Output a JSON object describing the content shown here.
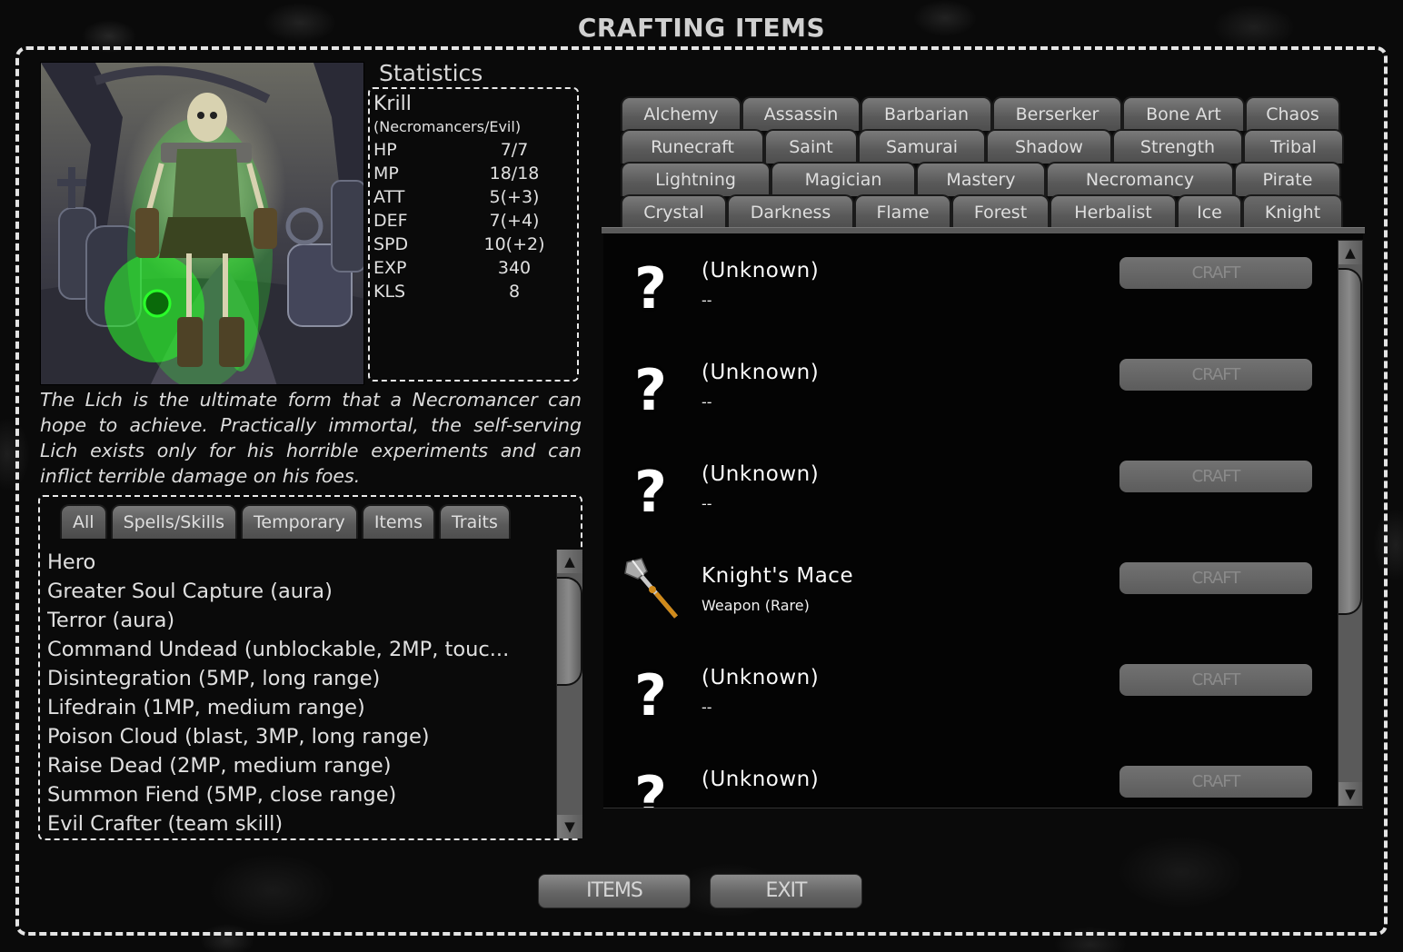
{
  "title": "CRAFTING ITEMS",
  "character": {
    "portrait_icon": "lich-portrait",
    "stats_heading": "Statistics",
    "name": "Krill",
    "faction": "(Necromancers/Evil)",
    "stats": [
      {
        "label": "HP",
        "value": "7/7"
      },
      {
        "label": "MP",
        "value": "18/18"
      },
      {
        "label": "ATT",
        "value": "5(+3)"
      },
      {
        "label": "DEF",
        "value": "7(+4)"
      },
      {
        "label": "SPD",
        "value": "10(+2)"
      },
      {
        "label": "EXP",
        "value": "340"
      },
      {
        "label": "KLS",
        "value": "8"
      }
    ],
    "description": "The Lich is the ultimate form that a Necromancer can hope to achieve. Practically immortal, the self-serving Lich exists only for his horrible experiments and can inflict terrible damage on his foes."
  },
  "abilities": {
    "tabs": [
      {
        "label": "All",
        "active": true
      },
      {
        "label": "Spells/Skills"
      },
      {
        "label": "Temporary"
      },
      {
        "label": "Items"
      },
      {
        "label": "Traits"
      }
    ],
    "items": [
      "Hero",
      "Greater Soul Capture (aura)",
      "Terror (aura)",
      "Command Undead (unblockable, 2MP, touc...",
      "Disintegration (5MP, long range)",
      "Lifedrain (1MP, medium range)",
      "Poison Cloud (blast, 3MP, long range)",
      "Raise Dead (2MP, medium range)",
      "Summon Fiend (5MP, close range)",
      "Evil Crafter (team skill)"
    ],
    "scroll_up_icon": "up-arrow-icon",
    "scroll_down_icon": "down-arrow-icon"
  },
  "class_tabs": {
    "rows": [
      [
        "Alchemy",
        "Assassin",
        "Barbarian",
        "Berserker",
        "Bone Art",
        "Chaos"
      ],
      [
        "Runecraft",
        "Saint",
        "Samurai",
        "Shadow",
        "Strength",
        "Tribal"
      ],
      [
        "Lightning",
        "Magician",
        "Mastery",
        "Necromancy",
        "Pirate"
      ],
      [
        "Crystal",
        "Darkness",
        "Flame",
        "Forest",
        "Herbalist",
        "Ice",
        "Knight"
      ]
    ],
    "active": "Knight"
  },
  "recipes": {
    "items": [
      {
        "name": "(Unknown)",
        "sub": "--",
        "icon": "question-mark-icon",
        "craft_label": "CRAFT",
        "craft_enabled": false
      },
      {
        "name": "(Unknown)",
        "sub": "--",
        "icon": "question-mark-icon",
        "craft_label": "CRAFT",
        "craft_enabled": false
      },
      {
        "name": "(Unknown)",
        "sub": "--",
        "icon": "question-mark-icon",
        "craft_label": "CRAFT",
        "craft_enabled": false
      },
      {
        "name": "Knight's Mace",
        "sub": "Weapon (Rare)",
        "icon": "mace-icon",
        "craft_label": "CRAFT",
        "craft_enabled": false
      },
      {
        "name": "(Unknown)",
        "sub": "--",
        "icon": "question-mark-icon",
        "craft_label": "CRAFT",
        "craft_enabled": false
      },
      {
        "name": "(Unknown)",
        "sub": "--",
        "icon": "question-mark-icon",
        "craft_label": "CRAFT",
        "craft_enabled": false
      }
    ],
    "question_glyph": "?"
  },
  "buttons": {
    "items": "ITEMS",
    "exit": "EXIT"
  },
  "glyphs": {
    "up": "▲",
    "down": "▼"
  }
}
